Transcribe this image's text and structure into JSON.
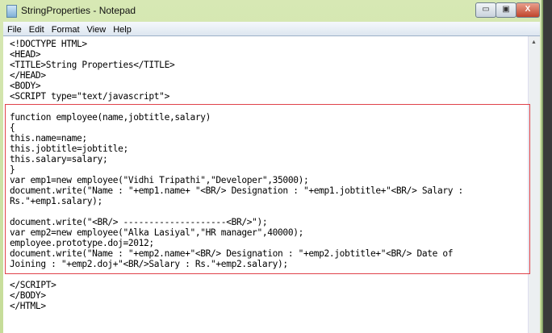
{
  "window": {
    "title": "StringProperties - Notepad",
    "minimize": "▭",
    "maximize": "▣",
    "close": "X"
  },
  "menu": [
    "File",
    "Edit",
    "Format",
    "View",
    "Help"
  ],
  "lines": [
    "<!DOCTYPE HTML>",
    "<HEAD>",
    "<TITLE>String Properties</TITLE>",
    "</HEAD>",
    "<BODY>",
    "<SCRIPT type=\"text/javascript\">",
    "",
    "function employee(name,jobtitle,salary)",
    "{",
    "this.name=name;",
    "this.jobtitle=jobtitle;",
    "this.salary=salary;",
    "}",
    "var emp1=new employee(\"Vidhi Tripathi\",\"Developer\",35000);",
    "document.write(\"Name : \"+emp1.name+ \"<BR/> Designation : \"+emp1.jobtitle+\"<BR/> Salary :",
    "Rs.\"+emp1.salary);",
    "",
    "document.write(\"<BR/> --------------------<BR/>\");",
    "var emp2=new employee(\"Alka Lasiyal\",\"HR manager\",40000);",
    "employee.prototype.doj=2012;",
    "document.write(\"Name : \"+emp2.name+\"<BR/> Designation : \"+emp2.jobtitle+\"<BR/> Date of",
    "Joining : \"+emp2.doj+\"<BR/>Salary : Rs.\"+emp2.salary);",
    "",
    "</SCRIPT>",
    "</BODY>",
    "</HTML>"
  ],
  "colors": {
    "highlight": "#e0424a"
  }
}
